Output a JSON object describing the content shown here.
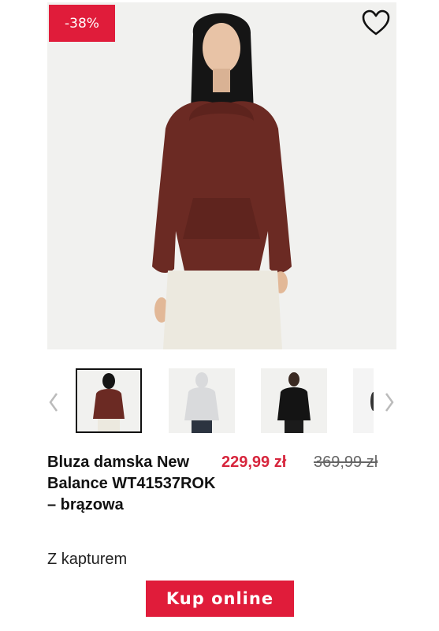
{
  "product": {
    "discount_badge": "-38%",
    "title": "Bluza damska New Balance WT41537ROK – brązowa",
    "price_current": "229,99 zł",
    "price_original": "369,99 zł",
    "subtitle": "Z kapturem",
    "buy_label": "Kup online"
  },
  "gallery": {
    "selected_index": 0,
    "thumbnails": [
      {
        "color": "#6b2a23"
      },
      {
        "color": "#d9dadc"
      },
      {
        "color": "#141414"
      },
      {
        "color": "#e6e6e6"
      }
    ]
  },
  "colors": {
    "accent": "#e01c3a",
    "price_accent": "#d7263d",
    "hoodie": "#6b2a23"
  },
  "icons": {
    "wishlist": "heart-outline-icon",
    "prev": "chevron-left-icon",
    "next": "chevron-right-icon"
  }
}
